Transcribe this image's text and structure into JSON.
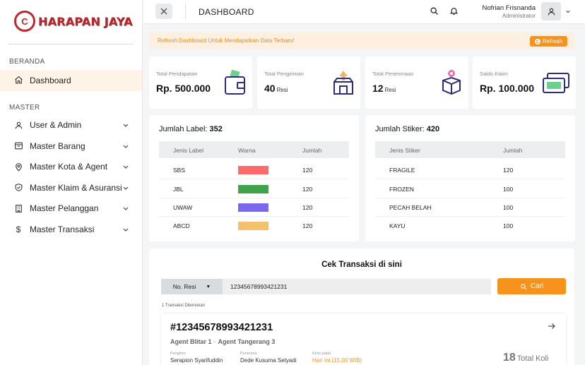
{
  "brand": {
    "mark": "C",
    "name": "HARAPAN JAYA"
  },
  "sidebar": {
    "section_home": "BERANDA",
    "section_master": "MASTER",
    "items": [
      {
        "label": "Dashboard",
        "icon": "home-icon"
      },
      {
        "label": "User & Admin",
        "icon": "user-icon"
      },
      {
        "label": "Master Barang",
        "icon": "box-icon"
      },
      {
        "label": "Master Kota & Agent",
        "icon": "map-pin-icon"
      },
      {
        "label": "Master Klaim & Asuransi",
        "icon": "shield-check-icon"
      },
      {
        "label": "Master Pelanggan",
        "icon": "building-icon"
      },
      {
        "label": "Master Transaksi",
        "icon": "dollar-icon"
      }
    ]
  },
  "topbar": {
    "title": "DASHBOARD",
    "user_name": "Nofrian Frisnanda",
    "user_role": "Administrator"
  },
  "alert": {
    "text": "Refresh Dashboard Untuk Mendapatkan Data Terbaru!",
    "button": "Refresh"
  },
  "stats": [
    {
      "label": "Total Pendapatan",
      "value": "Rp. 500.000",
      "unit": ""
    },
    {
      "label": "Total Pengiriman",
      "value": "40",
      "unit": "Resi"
    },
    {
      "label": "Total Penerimaan",
      "value": "12",
      "unit": "Resi"
    },
    {
      "label": "Saldo Klaim",
      "value": "Rp. 100.000",
      "unit": ""
    }
  ],
  "labels_panel": {
    "title": "Jumlah Label:",
    "count": "352",
    "headers": [
      "Jenis Label",
      "Warna",
      "Jumlah"
    ],
    "rows": [
      {
        "name": "SBS",
        "color": "#ff6b6b",
        "qty": "120"
      },
      {
        "name": "JBL",
        "color": "#3fa34d",
        "qty": "120"
      },
      {
        "name": "UWAW",
        "color": "#7b68ee",
        "qty": "120"
      },
      {
        "name": "ABCD",
        "color": "#f6c06f",
        "qty": "120"
      }
    ]
  },
  "stickers_panel": {
    "title": "Jumlah Stiker:",
    "count": "420",
    "headers": [
      "Jenis Stiker",
      "Jumlah"
    ],
    "rows": [
      {
        "name": "FRAGILE",
        "qty": "120"
      },
      {
        "name": "FROZEN",
        "qty": "100"
      },
      {
        "name": "PECAH BELAH",
        "qty": "100"
      },
      {
        "name": "KAYU",
        "qty": "100"
      }
    ]
  },
  "cek": {
    "title": "Cek Transaksi di sini",
    "search_type": "No. Resi",
    "search_value": "12345678993421231",
    "search_button": "Cari",
    "found_text": "1 Transaksi Ditemukan",
    "result": {
      "resi": "#12345678993421231",
      "origin": "Agent Blitar 1",
      "route_sep": "-",
      "destination": "Agent Tangerang 3",
      "sender_label": "Pengirim",
      "sender": "Serapion Syarifuddin",
      "receiver_label": "Penerima",
      "receiver": "Dede Kusuma Setyadi",
      "departure_label": "Kirim pada",
      "departure": "Hari Ini (15.00 WIB)",
      "koli_count": "18",
      "koli_label": "Total Koli"
    }
  }
}
